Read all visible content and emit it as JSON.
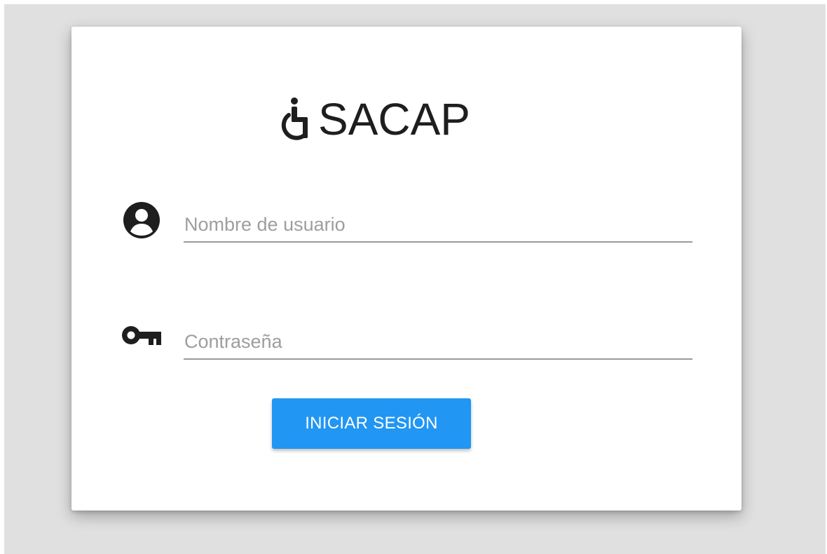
{
  "app": {
    "title": "SACAP",
    "logo_icon": "wheelchair-icon"
  },
  "form": {
    "username": {
      "icon": "user-circle-icon",
      "placeholder": "Nombre de usuario",
      "value": ""
    },
    "password": {
      "icon": "key-icon",
      "placeholder": "Contraseña",
      "value": ""
    },
    "submit_label": "INICIAR SESIÓN"
  },
  "colors": {
    "accent": "#2196f3",
    "background": "#e0e0e0",
    "card": "#ffffff",
    "text": "#1e1e1e",
    "placeholder": "#9e9e9e",
    "underline": "#9a9a9a"
  }
}
